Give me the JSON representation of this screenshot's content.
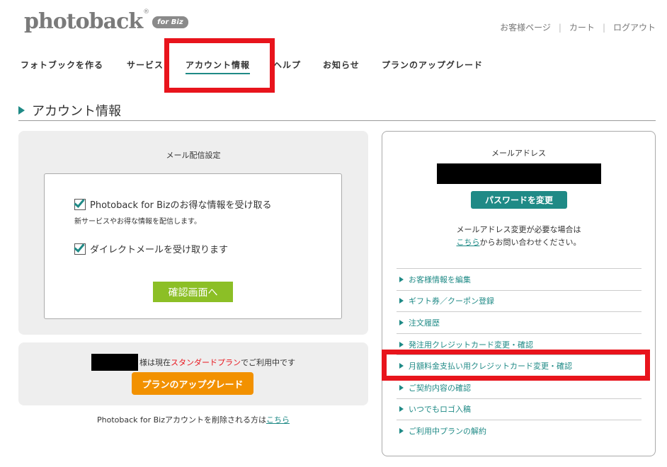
{
  "header": {
    "logo_text": "photoback",
    "logo_reg": "®",
    "logo_badge": "for Biz",
    "util_links": [
      "お客様ページ",
      "カート",
      "ログアウト"
    ],
    "util_sep": "|"
  },
  "nav": {
    "items": [
      "フォトブックを作る",
      "サービス",
      "アカウント情報",
      "ヘルプ",
      "お知らせ",
      "プランのアップグレード"
    ],
    "active_index": 2
  },
  "page": {
    "title": "アカウント情報"
  },
  "mail_settings": {
    "heading": "メール配信設定",
    "option1_label": "Photoback for Bizのお得な情報を受け取る",
    "option1_checked": true,
    "option1_desc": "新サービスやお得な情報を配信します。",
    "option2_label": "ダイレクトメールを受け取ります",
    "option2_checked": true,
    "confirm_button": "確認画面へ"
  },
  "plan": {
    "text_before": "様は現在",
    "plan_name": "スタンダードプラン",
    "text_after": "でご利用中です",
    "upgrade_button": "プランのアップグレード"
  },
  "delete": {
    "text": "Photoback for Bizアカウントを削除される方は",
    "link": "こちら"
  },
  "account": {
    "email_label": "メールアドレス",
    "password_button": "パスワードを変更",
    "note_line1": "メールアドレス変更が必要な場合は",
    "note_link": "こちら",
    "note_line2_rest": "からお問い合わせください。",
    "menu": [
      "お客様情報を編集",
      "ギフト券／クーポン登録",
      "注文履歴",
      "発注用クレジットカード変更・確認",
      "月額料金支払い用クレジットカード変更・確認",
      "ご契約内容の確認",
      "いつでもロゴ入稿",
      "ご利用中プランの解約"
    ]
  },
  "colors": {
    "accent": "#1f8a86",
    "highlight": "#e8141c",
    "confirm_button": "#8cbf26",
    "upgrade_button": "#f29100"
  }
}
